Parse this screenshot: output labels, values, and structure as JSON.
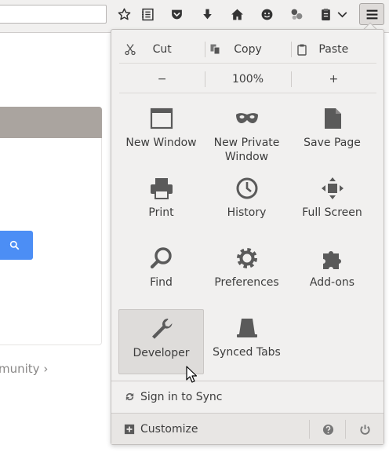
{
  "edit": {
    "cut": "Cut",
    "copy": "Copy",
    "paste": "Paste"
  },
  "zoom": {
    "out": "−",
    "level": "100%",
    "in": "+"
  },
  "tiles": [
    {
      "label": "New Window"
    },
    {
      "label": "New Private\nWindow"
    },
    {
      "label": "Save Page"
    },
    {
      "label": "Print"
    },
    {
      "label": "History"
    },
    {
      "label": "Full Screen"
    },
    {
      "label": "Find"
    },
    {
      "label": "Preferences"
    },
    {
      "label": "Add-ons"
    },
    {
      "label": "Developer"
    },
    {
      "label": "Synced Tabs"
    }
  ],
  "sync": {
    "label": "Sign in to Sync"
  },
  "footer": {
    "customize": "Customize"
  },
  "page": {
    "link": "munity ›"
  },
  "colors": {
    "search_button": "#4c8ef5",
    "card_header": "#aaa49f",
    "icon": "#5a5a5a"
  }
}
